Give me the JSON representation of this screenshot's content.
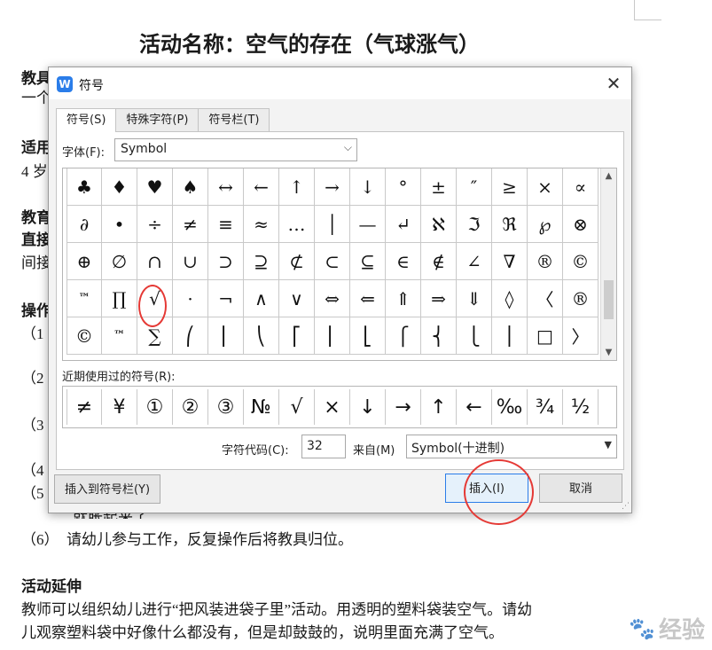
{
  "document": {
    "title": "活动名称：空气的存在（气球涨气）",
    "left_fragments": [
      "教具",
      "一个",
      "适用",
      "4 岁",
      "教育",
      "直接",
      "间接",
      "操作",
      "（1",
      "（2",
      "（3",
      "（4",
      "（5"
    ],
    "partial_line": "就胀起来了。",
    "item6": "（6）　请幼儿参与工作，反复操作后将教具归位。",
    "section_heading": "活动延伸",
    "para1": "教师可以组织幼儿进行“把风装进袋子里”活动。用透明的塑料袋装空气。请幼",
    "para2": "儿观察塑料袋中好像什么都没有，但是却鼓鼓的，说明里面充满了空气。"
  },
  "watermark": {
    "text": "经验",
    "icon": "paw-icon"
  },
  "dialog": {
    "title": "符号",
    "app_icon_letter": "W",
    "close_glyph": "✕",
    "tabs": [
      "符号(S)",
      "特殊字符(P)",
      "符号栏(T)"
    ],
    "font_label": "字体(F):",
    "font_value": "Symbol",
    "symbols": [
      [
        "♣",
        "♦",
        "♥",
        "♠",
        "↔",
        "←",
        "↑",
        "→",
        "↓",
        "°",
        "±",
        "″",
        "≥",
        "×",
        "∝"
      ],
      [
        "∂",
        "•",
        "÷",
        "≠",
        "≡",
        "≈",
        "…",
        "│",
        "—",
        "↵",
        "ℵ",
        "ℑ",
        "ℜ",
        "℘",
        "⊗"
      ],
      [
        "⊕",
        "∅",
        "∩",
        "∪",
        "⊃",
        "⊇",
        "⊄",
        "⊂",
        "⊆",
        "∈",
        "∉",
        "∠",
        "∇",
        "®",
        "©"
      ],
      [
        "™",
        "∏",
        "√",
        "·",
        "¬",
        "∧",
        "∨",
        "⇔",
        "⇐",
        "⇑",
        "⇒",
        "⇓",
        "◊",
        "〈",
        "®"
      ],
      [
        "©",
        "™",
        "∑",
        "⎛",
        "⎜",
        "⎝",
        "⎡",
        "⎢",
        "⎣",
        "⎧",
        "⎨",
        "⎩",
        "⎪",
        "□",
        "〉"
      ]
    ],
    "recent_label": "近期使用过的符号(R):",
    "recent_symbols": [
      "≠",
      "¥",
      "①",
      "②",
      "③",
      "№",
      "√",
      "×",
      "↓",
      "→",
      "↑",
      "←",
      "‰",
      "¾",
      "½"
    ],
    "char_code_label": "字符代码(C):",
    "char_code_value": "32",
    "from_label": "来自(M)",
    "from_value": "Symbol(十进制)",
    "insert_to_bar_button": "插入到符号栏(Y)",
    "insert_button": "插入(I)",
    "cancel_button": "取消"
  },
  "accent_colors": {
    "annotation": "#e53935",
    "focus": "#2b7de9"
  }
}
